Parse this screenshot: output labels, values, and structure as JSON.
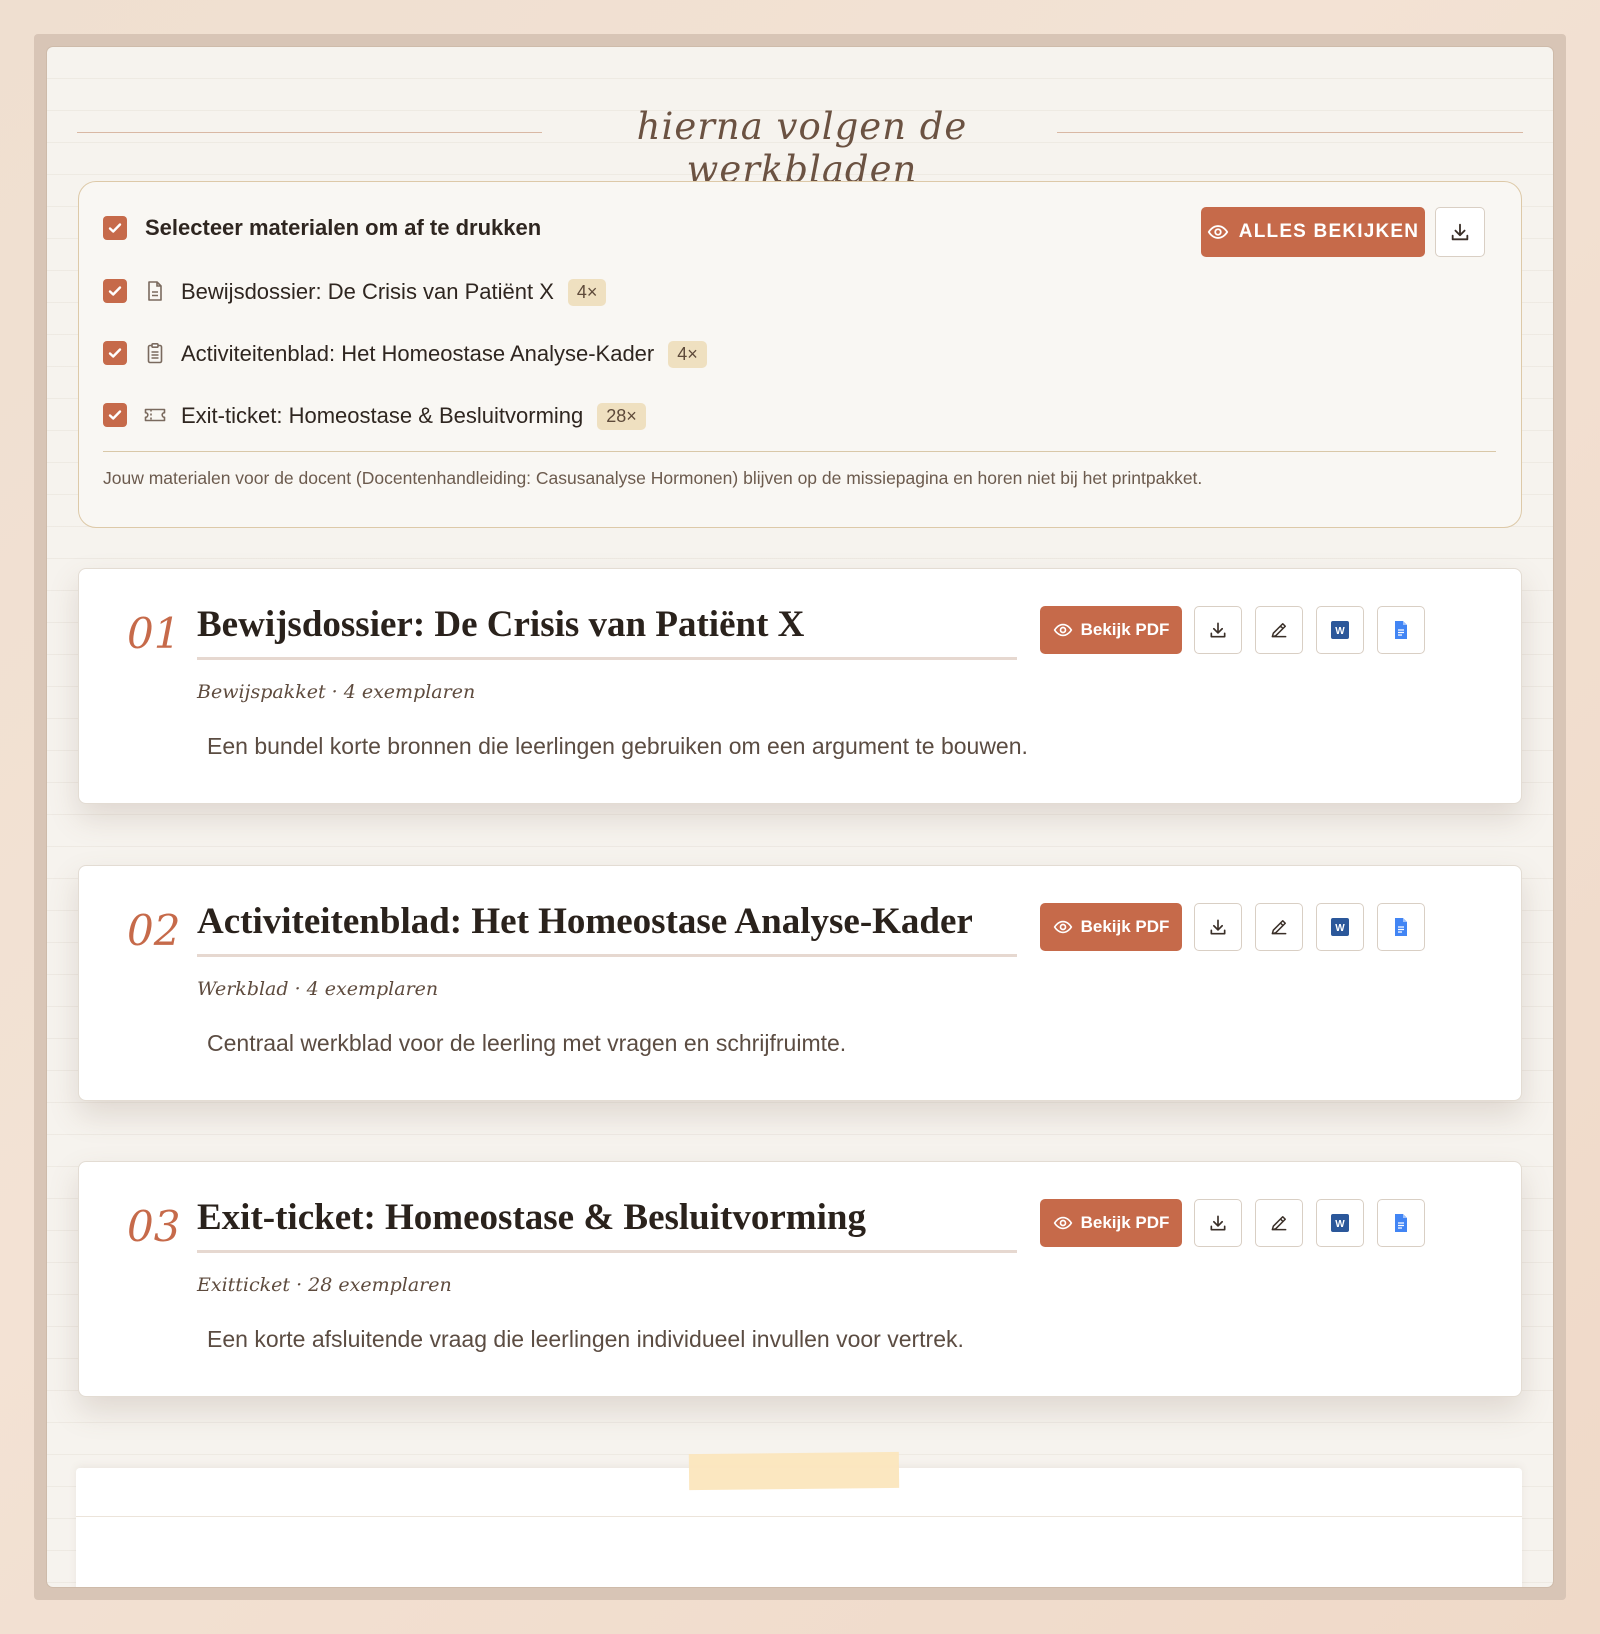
{
  "heading": "hierna volgen de werkbladen",
  "selection": {
    "select_all_label": "Selecteer materialen om af te drukken",
    "view_all_label": "ALLES BEKIJKEN",
    "items": [
      {
        "label": "Bewijsdossier: De Crisis van Patiënt X",
        "count": "4×",
        "icon": "document-icon"
      },
      {
        "label": "Activiteitenblad: Het Homeostase Analyse-Kader",
        "count": "4×",
        "icon": "clipboard-icon"
      },
      {
        "label": "Exit-ticket: Homeostase & Besluitvorming",
        "count": "28×",
        "icon": "ticket-icon"
      }
    ],
    "note": "Jouw materialen voor de docent (Docentenhandleiding: Casusanalyse Hormonen) blijven op de missiepagina en horen niet bij het printpakket."
  },
  "cards": [
    {
      "number": "01",
      "title": "Bewijsdossier: De Crisis van Patiënt X",
      "meta": "Bewijspakket · 4 exemplaren",
      "description": "Een bundel korte bronnen die leerlingen gebruiken om een argument te bouwen.",
      "pdf_label": "Bekijk PDF"
    },
    {
      "number": "02",
      "title": "Activiteitenblad: Het Homeostase Analyse-Kader",
      "meta": "Werkblad · 4 exemplaren",
      "description": "Centraal werkblad voor de leerling met vragen en schrijfruimte.",
      "pdf_label": "Bekijk PDF"
    },
    {
      "number": "03",
      "title": "Exit-ticket: Homeostase & Besluitvorming",
      "meta": "Exitticket · 28 exemplaren",
      "description": "Een korte afsluitende vraag die leerlingen individueel invullen voor vertrek.",
      "pdf_label": "Bekijk PDF"
    }
  ],
  "colors": {
    "accent": "#c66a4a",
    "badge_bg": "#efe0c0",
    "word_blue": "#2b579a",
    "docs_blue": "#4285f4"
  }
}
